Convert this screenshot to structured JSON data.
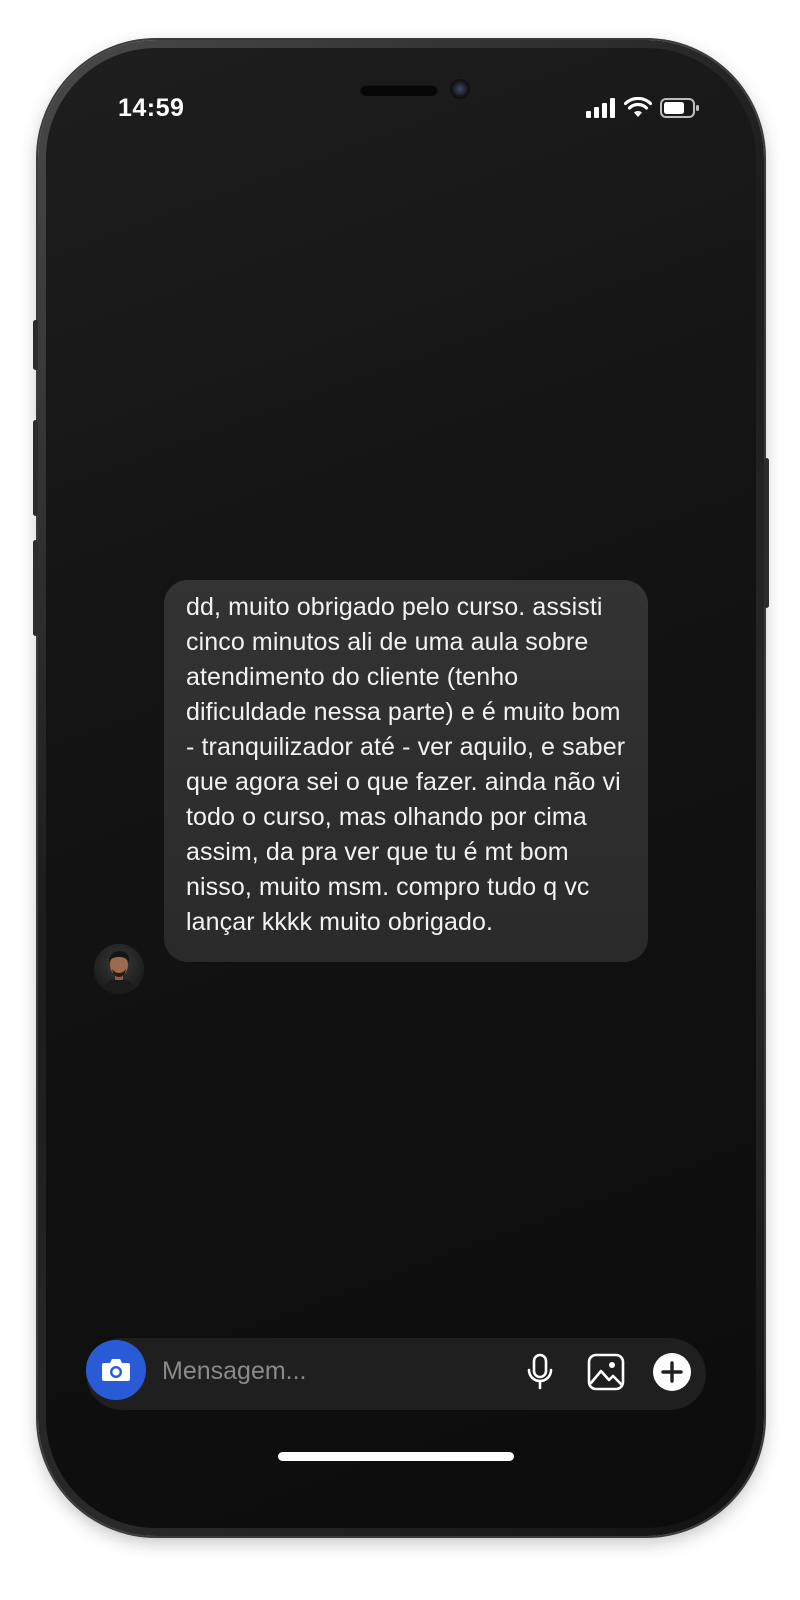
{
  "status_bar": {
    "time": "14:59",
    "icons": [
      "signal-icon",
      "wifi-icon",
      "battery-icon"
    ]
  },
  "conversation": {
    "messages": [
      {
        "sender": "other",
        "avatar": "avatar-photo",
        "text": "dd, muito obrigado pelo curso. assisti cinco minutos ali de uma aula sobre atendimento do cliente (tenho dificuldade nessa parte) e é muito bom - tranquilizador até - ver aquilo, e saber que agora sei o que fazer. ainda não vi todo o curso, mas olhando por cima assim, da pra ver que tu é mt bom nisso, muito msm. compro tudo q vc lançar kkkk muito obrigado."
      }
    ]
  },
  "composer": {
    "placeholder": "Mensagem...",
    "value": "",
    "icons": [
      "camera-icon",
      "microphone-icon",
      "gallery-icon",
      "plus-icon"
    ]
  },
  "colors": {
    "accent": "#2a5bd7",
    "screen_background": "#141414",
    "bubble_background": "#2f2f2f",
    "text": "#f2f2f2"
  }
}
